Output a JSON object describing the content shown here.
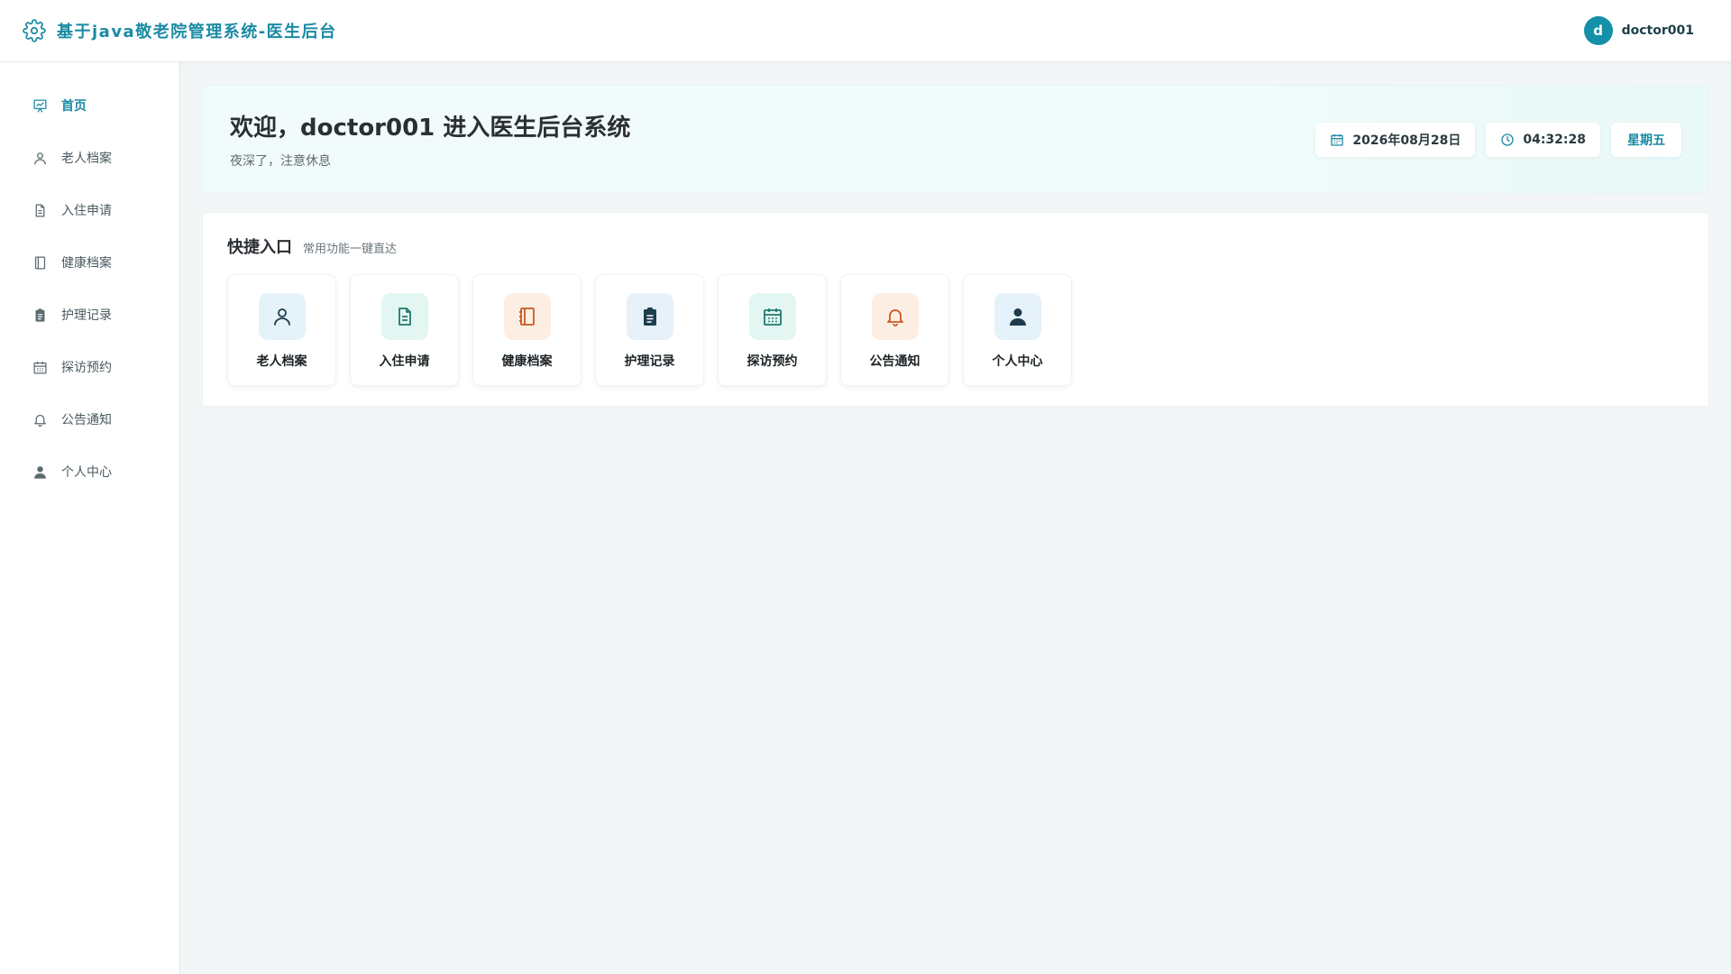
{
  "header": {
    "title": "基于java敬老院管理系统-医生后台",
    "avatar_letter": "d",
    "username": "doctor001",
    "icon": "gear-icon"
  },
  "sidebar": {
    "items": [
      {
        "label": "首页",
        "icon": "dashboard-icon",
        "active": true
      },
      {
        "label": "老人档案",
        "icon": "user-icon",
        "active": false
      },
      {
        "label": "入住申请",
        "icon": "document-icon",
        "active": false
      },
      {
        "label": "健康档案",
        "icon": "notebook-icon",
        "active": false
      },
      {
        "label": "护理记录",
        "icon": "clipboard-icon",
        "active": false
      },
      {
        "label": "探访预约",
        "icon": "calendar-icon",
        "active": false
      },
      {
        "label": "公告通知",
        "icon": "bell-icon",
        "active": false
      },
      {
        "label": "个人中心",
        "icon": "person-icon",
        "active": false
      }
    ]
  },
  "welcome": {
    "title": "欢迎，doctor001 进入医生后台系统",
    "subtitle": "夜深了，注意休息",
    "date": "2026年08月28日",
    "time": "04:32:28",
    "weekday": "星期五"
  },
  "quick": {
    "title": "快捷入口",
    "subtitle": "常用功能一键直达",
    "cards": [
      {
        "label": "老人档案",
        "icon": "user-icon",
        "bg": "#e6f2fa",
        "color": "#1d3d4d"
      },
      {
        "label": "入住申请",
        "icon": "document-icon",
        "bg": "#e3f6f2",
        "color": "#1f7a6e"
      },
      {
        "label": "健康档案",
        "icon": "notebook-icon",
        "bg": "#fdeee3",
        "color": "#c75a1f"
      },
      {
        "label": "护理记录",
        "icon": "clipboard-icon",
        "bg": "#e6f1fa",
        "color": "#1d3d4d"
      },
      {
        "label": "探访预约",
        "icon": "calendar-icon",
        "bg": "#e3f6f2",
        "color": "#1f7a6e"
      },
      {
        "label": "公告通知",
        "icon": "bell-icon",
        "bg": "#fdeee3",
        "color": "#c75a1f"
      },
      {
        "label": "个人中心",
        "icon": "person-icon",
        "bg": "#e6f2fa",
        "color": "#1d3d4d"
      }
    ]
  },
  "colors": {
    "accent": "#1a8ba3",
    "avatar": "#1490a8",
    "nav_text": "#4b5960"
  }
}
